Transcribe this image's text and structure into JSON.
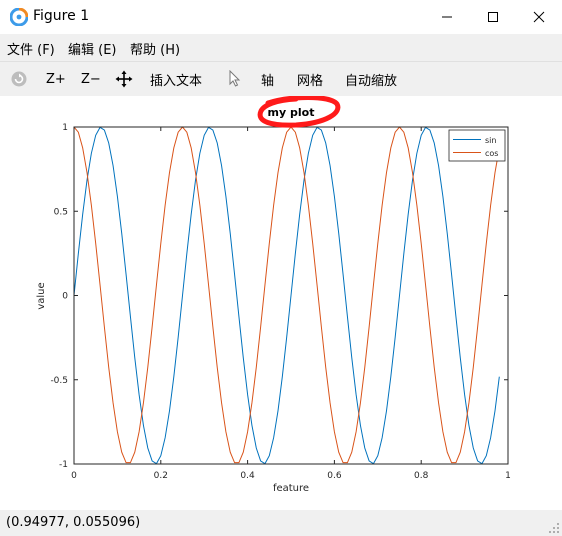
{
  "window": {
    "title": "Figure 1"
  },
  "menu": [
    {
      "label": "文件 (F)",
      "mnemonic": "F"
    },
    {
      "label": "编辑 (E)",
      "mnemonic": "E"
    },
    {
      "label": "帮助 (H)",
      "mnemonic": "H"
    }
  ],
  "toolbar": {
    "zoom_in": "Z+",
    "zoom_out": "Z−",
    "insert_text": "插入文本",
    "axes": "轴",
    "grid": "网格",
    "autoscale": "自动缩放"
  },
  "status": {
    "text": "(0.94977, 0.055096)"
  },
  "chart_data": {
    "type": "line",
    "title": "my plot",
    "xlabel": "feature",
    "ylabel": "value",
    "xlim": [
      0,
      1
    ],
    "ylim": [
      -1,
      1
    ],
    "x_ticks": [
      "0",
      "0.2",
      "0.4",
      "0.6",
      "0.8",
      "1"
    ],
    "y_ticks": [
      "-1",
      "-0.5",
      "0",
      "0.5",
      "1"
    ],
    "grid": false,
    "legend_position": "top-right",
    "x": [
      0.0,
      0.01,
      0.02,
      0.03,
      0.04,
      0.05,
      0.06,
      0.07,
      0.08,
      0.09,
      0.1,
      0.11,
      0.12,
      0.13,
      0.14,
      0.15,
      0.16,
      0.17,
      0.18,
      0.19,
      0.2,
      0.21,
      0.22,
      0.23,
      0.24,
      0.25,
      0.26,
      0.27,
      0.28,
      0.29,
      0.3,
      0.31,
      0.32,
      0.33,
      0.34,
      0.35,
      0.36,
      0.37,
      0.38,
      0.39,
      0.4,
      0.41,
      0.42,
      0.43,
      0.44,
      0.45,
      0.46,
      0.47,
      0.48,
      0.49,
      0.5,
      0.51,
      0.52,
      0.53,
      0.54,
      0.55,
      0.56,
      0.57,
      0.58,
      0.59,
      0.6,
      0.61,
      0.62,
      0.63,
      0.64,
      0.65,
      0.66,
      0.67,
      0.68,
      0.69,
      0.7,
      0.71,
      0.72,
      0.73,
      0.74,
      0.75,
      0.76,
      0.77,
      0.78,
      0.79,
      0.8,
      0.81,
      0.82,
      0.83,
      0.84,
      0.85,
      0.86,
      0.87,
      0.88,
      0.89,
      0.9,
      0.91,
      0.92,
      0.93,
      0.94,
      0.95,
      0.96,
      0.97,
      0.98
    ],
    "series": [
      {
        "name": "sin",
        "color": "#0072bd",
        "values": [
          0.0,
          0.249,
          0.482,
          0.685,
          0.844,
          0.951,
          0.998,
          0.982,
          0.905,
          0.771,
          0.588,
          0.368,
          0.125,
          -0.125,
          -0.368,
          -0.588,
          -0.771,
          -0.905,
          -0.982,
          -0.998,
          -0.951,
          -0.844,
          -0.685,
          -0.482,
          -0.249,
          0.0,
          0.249,
          0.482,
          0.685,
          0.844,
          0.951,
          0.998,
          0.982,
          0.905,
          0.771,
          0.588,
          0.368,
          0.125,
          -0.125,
          -0.368,
          -0.588,
          -0.771,
          -0.905,
          -0.982,
          -0.998,
          -0.951,
          -0.844,
          -0.685,
          -0.482,
          -0.249,
          0.0,
          0.249,
          0.482,
          0.685,
          0.844,
          0.951,
          0.998,
          0.982,
          0.905,
          0.771,
          0.588,
          0.368,
          0.125,
          -0.125,
          -0.368,
          -0.588,
          -0.771,
          -0.905,
          -0.982,
          -0.998,
          -0.951,
          -0.844,
          -0.685,
          -0.482,
          -0.249,
          0.0,
          0.249,
          0.482,
          0.685,
          0.844,
          0.951,
          0.998,
          0.982,
          0.905,
          0.771,
          0.588,
          0.368,
          0.125,
          -0.125,
          -0.368,
          -0.588,
          -0.771,
          -0.905,
          -0.982,
          -0.998,
          -0.951,
          -0.844,
          -0.685,
          -0.482
        ]
      },
      {
        "name": "cos",
        "color": "#d95319",
        "values": [
          1.0,
          0.969,
          0.876,
          0.729,
          0.536,
          0.309,
          0.063,
          -0.187,
          -0.426,
          -0.637,
          -0.809,
          -0.93,
          -0.992,
          -0.992,
          -0.93,
          -0.809,
          -0.637,
          -0.426,
          -0.187,
          0.063,
          0.309,
          0.536,
          0.729,
          0.876,
          0.969,
          1.0,
          0.969,
          0.876,
          0.729,
          0.536,
          0.309,
          0.063,
          -0.187,
          -0.426,
          -0.637,
          -0.809,
          -0.93,
          -0.992,
          -0.992,
          -0.93,
          -0.809,
          -0.637,
          -0.426,
          -0.187,
          0.063,
          0.309,
          0.536,
          0.729,
          0.876,
          0.969,
          1.0,
          0.969,
          0.876,
          0.729,
          0.536,
          0.309,
          0.063,
          -0.187,
          -0.426,
          -0.637,
          -0.809,
          -0.93,
          -0.992,
          -0.992,
          -0.93,
          -0.809,
          -0.637,
          -0.426,
          -0.187,
          0.063,
          0.309,
          0.536,
          0.729,
          0.876,
          0.969,
          1.0,
          0.969,
          0.876,
          0.729,
          0.536,
          0.309,
          0.063,
          -0.187,
          -0.426,
          -0.637,
          -0.809,
          -0.93,
          -0.992,
          -0.992,
          -0.93,
          -0.809,
          -0.637,
          -0.426,
          -0.187,
          0.063,
          0.309,
          0.536,
          0.729,
          0.876
        ]
      }
    ],
    "annotations": [
      {
        "type": "freehand-circle",
        "around": "title",
        "color": "#ff0000"
      }
    ]
  }
}
